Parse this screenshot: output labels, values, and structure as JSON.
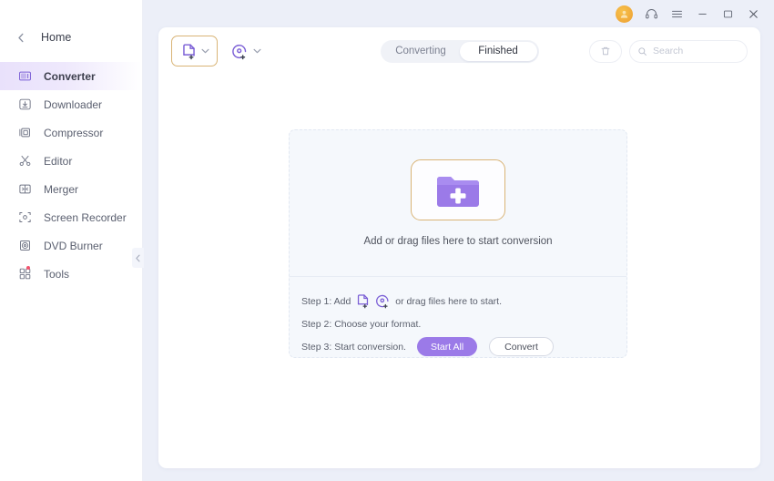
{
  "titlebar": {
    "avatar_name": "user-avatar",
    "support_label": "Support",
    "menu_label": "Menu",
    "minimize_label": "Minimize",
    "maximize_label": "Maximize",
    "close_label": "Close"
  },
  "sidebar": {
    "home_label": "Home",
    "collapse_label": "Collapse sidebar",
    "items": [
      {
        "label": "Converter",
        "icon": "converter-icon",
        "active": true,
        "badge": false
      },
      {
        "label": "Downloader",
        "icon": "downloader-icon",
        "active": false,
        "badge": false
      },
      {
        "label": "Compressor",
        "icon": "compressor-icon",
        "active": false,
        "badge": false
      },
      {
        "label": "Editor",
        "icon": "scissors-icon",
        "active": false,
        "badge": false
      },
      {
        "label": "Merger",
        "icon": "merger-icon",
        "active": false,
        "badge": false
      },
      {
        "label": "Screen Recorder",
        "icon": "screen-recorder-icon",
        "active": false,
        "badge": false
      },
      {
        "label": "DVD Burner",
        "icon": "dvd-burner-icon",
        "active": false,
        "badge": false
      },
      {
        "label": "Tools",
        "icon": "tools-grid-icon",
        "active": false,
        "badge": true
      }
    ]
  },
  "toolbar": {
    "add_files_label": "Add Files",
    "add_files_icon": "add-file-icon",
    "add_disc_label": "Add from Disc",
    "add_disc_icon": "add-disc-icon",
    "dropdown_icon": "chevron-down-icon",
    "delete_label": "Delete",
    "delete_icon": "trash-icon",
    "search_icon": "search-icon",
    "search_value": "",
    "search_placeholder": "Search",
    "tabs": [
      {
        "label": "Converting",
        "active": false
      },
      {
        "label": "Finished",
        "active": true
      }
    ]
  },
  "dropzone": {
    "folder_icon": "add-folder-plus-icon",
    "caption": "Add or drag files here to start conversion",
    "steps": {
      "step1_prefix": "Step 1: Add",
      "step1_suffix": "or drag files here to start.",
      "step2": "Step 2: Choose your format.",
      "step3": "Step 3: Start conversion.",
      "start_all_label": "Start All",
      "convert_label": "Convert"
    }
  },
  "colors": {
    "accent_purple": "#7b5fd6",
    "start_all_purple": "#9b7ae8",
    "focus_gold": "#d9b476",
    "badge_red": "#f2536d",
    "avatar_orange": "#f0a93a",
    "app_bg": "#eceff8",
    "panel_bg": "#ffffff",
    "dropzone_bg": "#f5f8fc"
  }
}
